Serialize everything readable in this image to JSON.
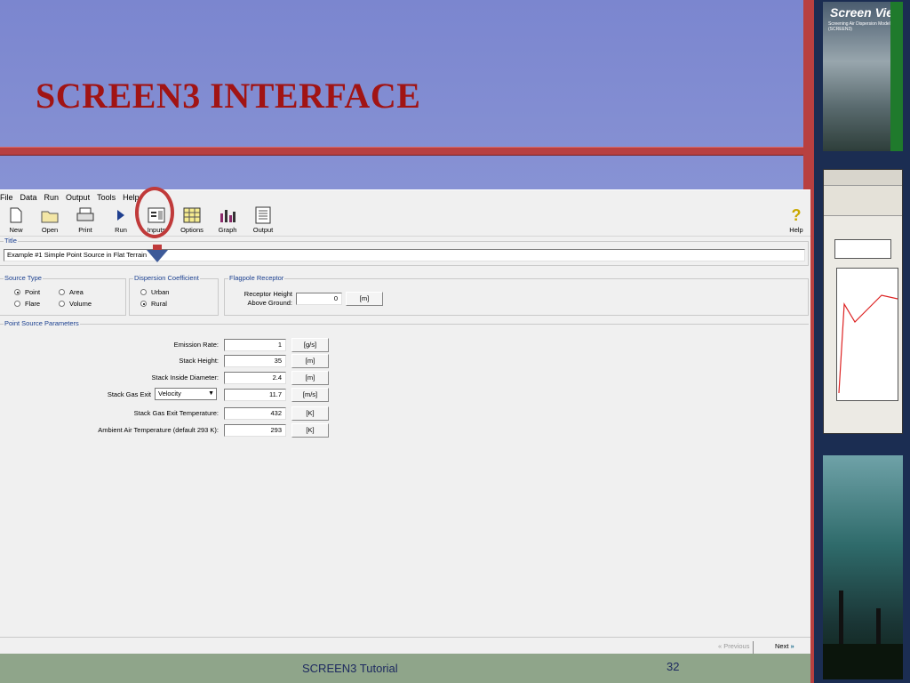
{
  "slide": {
    "title": "SCREEN3 INTERFACE",
    "footer": "SCREEN3 Tutorial",
    "page_number": "32"
  },
  "side_thumbnails": {
    "thumb1_title": "Screen View",
    "thumb1_subtitle": "Screening Air Dispersion Model (SCREEN3)"
  },
  "menu": [
    "File",
    "Data",
    "Run",
    "Output",
    "Tools",
    "Help"
  ],
  "toolbar": {
    "new": "New",
    "open": "Open",
    "print": "Print",
    "run": "Run",
    "inputs": "Inputs",
    "options": "Options",
    "graph": "Graph",
    "output": "Output",
    "help": "Help"
  },
  "title_section": {
    "legend": "Title",
    "value": "Example #1 Simple Point Source in Flat Terrain"
  },
  "source_type": {
    "legend": "Source Type",
    "options": [
      "Point",
      "Area",
      "Flare",
      "Volume"
    ],
    "selected": "Point"
  },
  "dispersion": {
    "legend": "Dispersion Coefficient",
    "options": [
      "Urban",
      "Rural"
    ],
    "selected": "Rural"
  },
  "flagpole": {
    "legend": "Flagpole Receptor",
    "label_line1": "Receptor Height",
    "label_line2": "Above Ground:",
    "value": "0",
    "unit": "[m]"
  },
  "point_source": {
    "legend": "Point Source Parameters",
    "rows": [
      {
        "label": "Emission Rate:",
        "value": "1",
        "unit": "[g/s]"
      },
      {
        "label": "Stack Height:",
        "value": "35",
        "unit": "[m]"
      },
      {
        "label": "Stack Inside Diameter:",
        "value": "2.4",
        "unit": "[m]"
      },
      {
        "label": "Stack Gas Exit",
        "value": "11.7",
        "unit": "[m/s]"
      },
      {
        "label": "Stack Gas Exit Temperature:",
        "value": "432",
        "unit": "[K]"
      },
      {
        "label": "Ambient Air Temperature (default 293 K):",
        "value": "293",
        "unit": "[K]"
      }
    ],
    "exit_select": "Velocity"
  },
  "nav": {
    "previous": "Previous",
    "next": "Next"
  },
  "colors": {
    "title_red": "#a11414",
    "accent_red": "#c03a3a",
    "legend_blue": "#1a3f8f"
  }
}
